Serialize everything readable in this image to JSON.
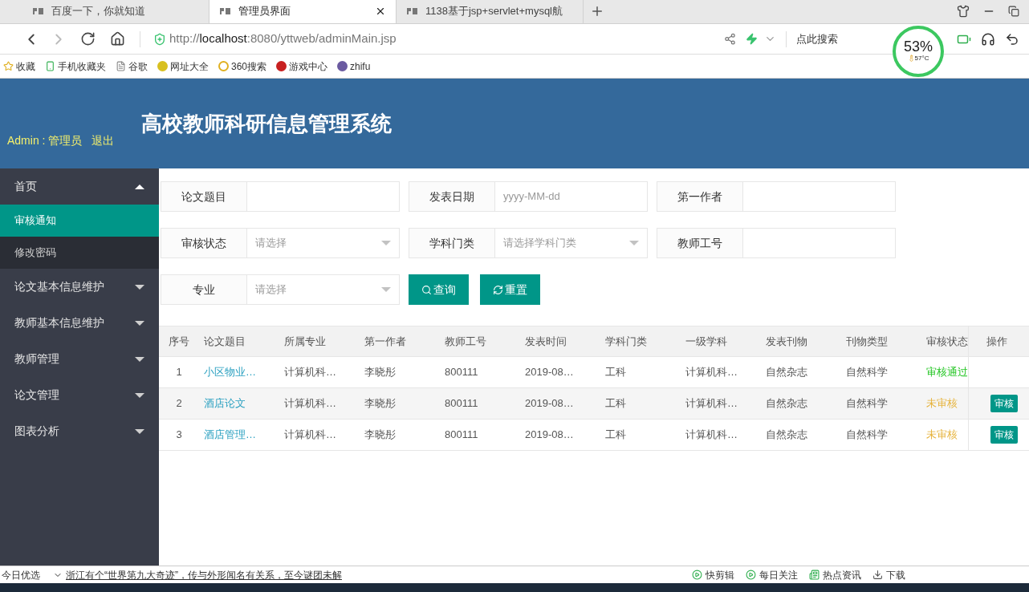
{
  "browser": {
    "tabs": [
      {
        "title": "百度一下，你就知道",
        "selected": false
      },
      {
        "title": "管理员界面",
        "selected": true
      },
      {
        "title": "1138基于jsp+servlet+mysql航",
        "selected": false
      }
    ],
    "address": {
      "host_prefix": "http://",
      "host": "localhost",
      "rest": ":8080/yttweb/adminMain.jsp"
    },
    "search_placeholder": "点此搜索",
    "cpu": "53%",
    "temperature": "57°C",
    "bookmarks": [
      "收藏",
      "手机收藏夹",
      "谷歌",
      "网址大全",
      "360搜索",
      "游戏中心",
      "zhifu"
    ]
  },
  "header": {
    "title": "高校教师科研信息管理系统",
    "user": "Admin : 管理员",
    "logout": "退出"
  },
  "sidebar": {
    "items": [
      {
        "label": "首页",
        "expanded": true,
        "children": [
          {
            "label": "审核通知",
            "selected": true
          },
          {
            "label": "修改密码",
            "selected": false
          }
        ]
      },
      {
        "label": "论文基本信息维护",
        "expanded": false
      },
      {
        "label": "教师基本信息维护",
        "expanded": false
      },
      {
        "label": "教师管理",
        "expanded": false
      },
      {
        "label": "论文管理",
        "expanded": false
      },
      {
        "label": "图表分析",
        "expanded": false
      }
    ]
  },
  "filters": {
    "fields": [
      {
        "label": "论文题目",
        "kind": "text"
      },
      {
        "label": "发表日期",
        "kind": "text",
        "placeholder": "yyyy-MM-dd"
      },
      {
        "label": "第一作者",
        "kind": "text"
      },
      {
        "label": "审核状态",
        "kind": "select",
        "placeholder": "请选择"
      },
      {
        "label": "学科门类",
        "kind": "select",
        "placeholder": "请选择学科门类"
      },
      {
        "label": "教师工号",
        "kind": "text"
      },
      {
        "label": "专业",
        "kind": "select",
        "placeholder": "请选择"
      }
    ],
    "buttons": [
      {
        "label": "查询",
        "kind": "search"
      },
      {
        "label": "重置",
        "kind": "reset"
      }
    ]
  },
  "table": {
    "columns": [
      "序号",
      "论文题目",
      "所属专业",
      "第一作者",
      "教师工号",
      "发表时间",
      "学科门类",
      "一级学科",
      "发表刊物",
      "刊物类型",
      "审核状态",
      "操作"
    ],
    "rows": [
      {
        "cells": [
          "1",
          "小区物业…",
          "计算机科…",
          "李晓彤",
          "800111",
          "2019-08…",
          "工科",
          "计算机科…",
          "自然杂志",
          "自然科学"
        ],
        "status": "审核通过",
        "color": "#22c522"
      },
      {
        "cells": [
          "2",
          "酒店论文",
          "计算机科…",
          "李晓彤",
          "800111",
          "2019-08…",
          "工科",
          "计算机科…",
          "自然杂志",
          "自然科学"
        ],
        "status": "未审核",
        "color": "#e6b33c",
        "action": "审核"
      },
      {
        "cells": [
          "3",
          "酒店管理…",
          "计算机科…",
          "李晓彤",
          "800111",
          "2019-08…",
          "工科",
          "计算机科…",
          "自然杂志",
          "自然科学"
        ],
        "status": "未审核",
        "color": "#e6b33c",
        "action": "审核"
      }
    ]
  },
  "status_bar": {
    "left": "今日优选",
    "headline": "浙江有个“世界第九大奇迹”，传与外形闻名有关系，至今谜团未解",
    "items": [
      "快剪辑",
      "每日关注",
      "热点资讯",
      "下载"
    ]
  }
}
